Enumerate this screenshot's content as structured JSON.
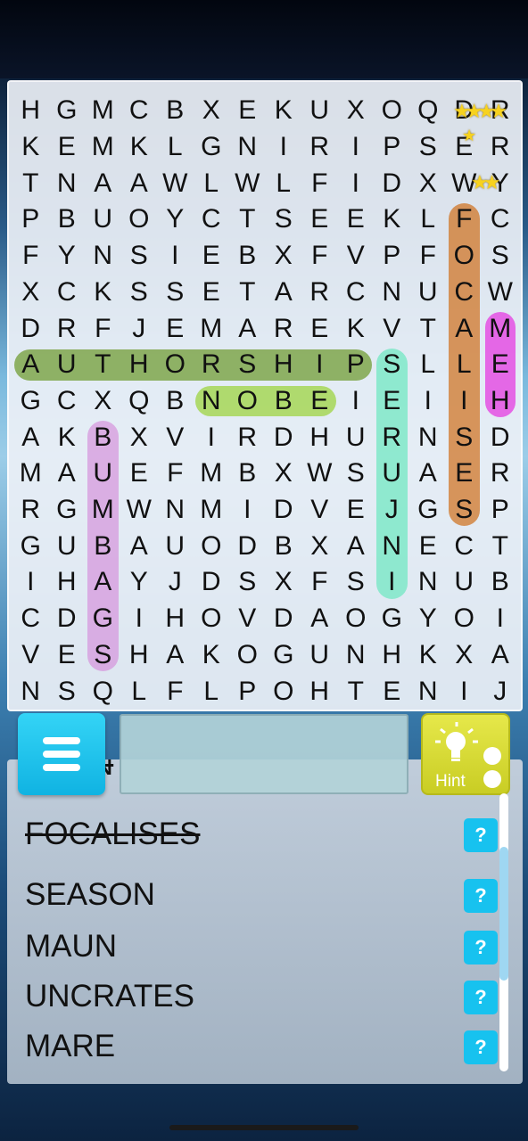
{
  "grid": {
    "rows": [
      "HGMCBXEKUXOQDR",
      "KEMKLGNIRIPSER",
      "TNAAWLWLFIDXWY",
      "PBUOYCTSEEKLFC",
      "FYNSIEBXFVPFOS",
      "XCKSSETARCNUCW",
      "DRFJEMAREKVTAM",
      "AUTHORSHIPSLLE",
      "GCXQBNOBEIEIIH",
      "AKBXVIRDHURNSD",
      "MAUEFMBXWSUAER",
      "RGMWNMIDVEJGSP",
      "GUBAUODBXANECT",
      "IHAYJDSXFSINUB",
      "CDGIHOVDAOGYOI",
      "VESHAKOGUNHKXA",
      "NSQLFLPOHTENIJ"
    ]
  },
  "highlights": [
    {
      "word": "AUTHORSHIP",
      "row": 7,
      "col": 0,
      "len": 10,
      "dir": "h",
      "color": "#6e9a2e"
    },
    {
      "word": "NOBE",
      "row": 8,
      "col": 5,
      "len": 4,
      "dir": "h",
      "color": "#9bd23a"
    },
    {
      "word": "FOCALISES",
      "row": 3,
      "col": 12,
      "len": 9,
      "dir": "v",
      "color": "#d07220"
    },
    {
      "word": "MEH",
      "row": 6,
      "col": 13,
      "len": 3,
      "dir": "v",
      "color": "#e535e0"
    },
    {
      "word": "SERUJNI",
      "row": 7,
      "col": 10,
      "len": 7,
      "dir": "v",
      "color": "#6ee8c0"
    },
    {
      "word": "BUMBAGS",
      "row": 9,
      "col": 2,
      "len": 7,
      "dir": "v",
      "color": "#d595dd"
    }
  ],
  "hint": {
    "label": "Hint",
    "icon": "lightbulb-icon"
  },
  "menu": {
    "icon": "hamburger-icon"
  },
  "current_word": "",
  "word_list": [
    {
      "word": "EBON",
      "found": true
    },
    {
      "word": "FOCALISES",
      "found": true
    },
    {
      "word": "SEASON",
      "found": false
    },
    {
      "word": "MAUN",
      "found": false
    },
    {
      "word": "UNCRATES",
      "found": false
    },
    {
      "word": "MARE",
      "found": false
    }
  ],
  "hint_button_label": "?"
}
